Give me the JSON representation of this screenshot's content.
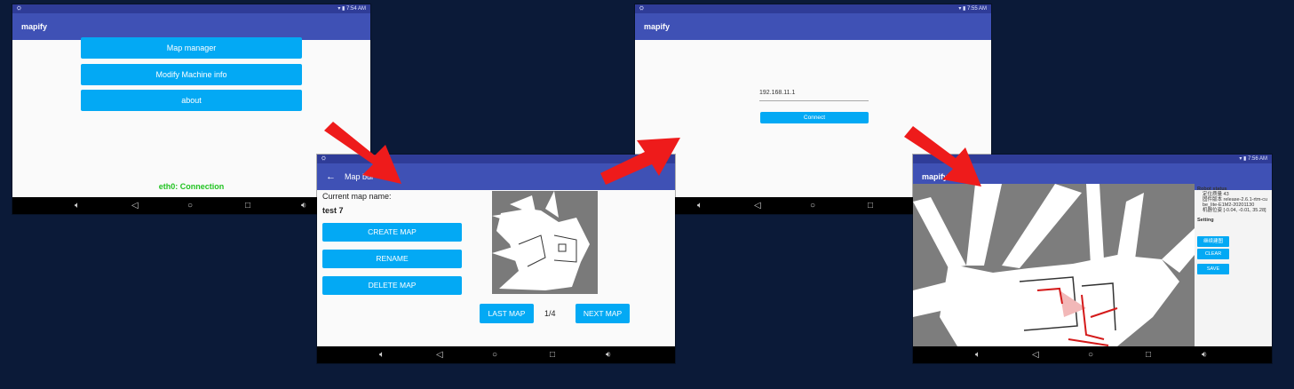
{
  "screen1": {
    "status_time": "7:54 AM",
    "app_title": "mapify",
    "buttons": [
      "Map manager",
      "Modify Machine info",
      "about"
    ],
    "connection_status": "eth0: Connection"
  },
  "screen2": {
    "status_time": "",
    "title": "Map bui",
    "current_map_label": "Current map name:",
    "current_map_name": "test 7",
    "buttons": {
      "create": "CREATE MAP",
      "rename": "RENAME",
      "delete": "DELETE MAP"
    },
    "last_map": "LAST MAP",
    "next_map": "NEXT MAP",
    "page_indicator": "1/4"
  },
  "screen3": {
    "status_time": "7:55 AM",
    "app_title": "mapify",
    "ip_value": "192.168.11.1",
    "connect_label": "Connect"
  },
  "screen4": {
    "status_time": "7:56 AM",
    "app_title": "mapify",
    "robot_status_heading": "Robot status",
    "status_lines": [
      "定位质量 43",
      "固件版本 release-2.6.1-rtm-cu",
      "be_lite-E1M2-20201130",
      "机器位姿 [-0.04, -0.01, 35.28]"
    ],
    "setting_heading": "Setting",
    "setting_buttons": [
      "继续建图",
      "CLEAR",
      "SAVE"
    ]
  },
  "nav_icons": [
    "volume-icon",
    "back-icon",
    "home-icon",
    "recents-icon",
    "volume-up-icon"
  ],
  "colors": {
    "background": "#0b1a38",
    "appbar": "#3f51b5",
    "button": "#03a9f4",
    "arrow": "#ee1b1b",
    "connection": "#22c322"
  }
}
